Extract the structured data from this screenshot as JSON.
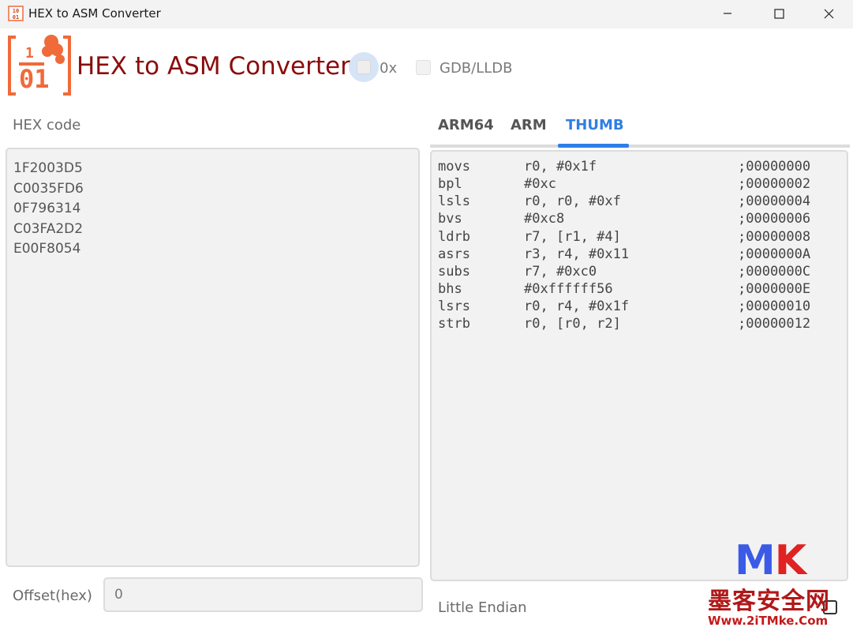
{
  "window": {
    "title": "HEX to ASM Converter",
    "icon_text": "1001",
    "controls": [
      "minimize-icon",
      "maximize-icon",
      "close-icon"
    ]
  },
  "header": {
    "app_title": "HEX to ASM Converter",
    "ox_option": {
      "label": "0x",
      "checked": false
    },
    "gdb_option": {
      "label": "GDB/LLDB",
      "checked": false
    }
  },
  "hex_panel": {
    "label": "HEX code",
    "lines": [
      "1F2003D5",
      "C0035FD6",
      "0F796314",
      "C03FA2D2",
      "E00F8054"
    ]
  },
  "tabs": [
    {
      "label": "ARM64",
      "active": false
    },
    {
      "label": "ARM",
      "active": false
    },
    {
      "label": "THUMB",
      "active": true
    }
  ],
  "asm_panel": {
    "rows": [
      {
        "mnemonic": "movs",
        "operands": "r0, #0x1f",
        "address": ";00000000"
      },
      {
        "mnemonic": "bpl",
        "operands": "#0xc",
        "address": ";00000002"
      },
      {
        "mnemonic": "lsls",
        "operands": "r0, r0, #0xf",
        "address": ";00000004"
      },
      {
        "mnemonic": "bvs",
        "operands": "#0xc8",
        "address": ";00000006"
      },
      {
        "mnemonic": "ldrb",
        "operands": "r7, [r1, #4]",
        "address": ";00000008"
      },
      {
        "mnemonic": "asrs",
        "operands": "r3, r4, #0x11",
        "address": ";0000000A"
      },
      {
        "mnemonic": "subs",
        "operands": "r7, #0xc0",
        "address": ";0000000C"
      },
      {
        "mnemonic": "bhs",
        "operands": "#0xffffff56",
        "address": ";0000000E"
      },
      {
        "mnemonic": "lsrs",
        "operands": "r0, r4, #0x1f",
        "address": ";00000010"
      },
      {
        "mnemonic": "strb",
        "operands": "r0, [r0, r2]",
        "address": ";00000012"
      }
    ]
  },
  "offset": {
    "label": "Offset(hex)",
    "value": "0"
  },
  "endian": {
    "label": "Little Endian",
    "checked": false
  },
  "watermark": {
    "mk_m": "M",
    "mk_k": "K",
    "cn": "墨客安全网",
    "url": "Www.2iTMke.Com"
  },
  "colors": {
    "title_red": "#8b0c0c",
    "tab_active": "#2f7ee7",
    "logo_orange": "#f06a3a"
  }
}
